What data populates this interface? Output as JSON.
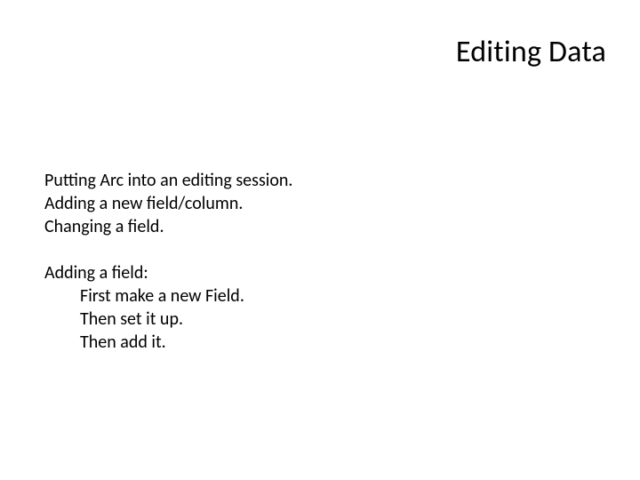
{
  "title": "Editing Data",
  "section1": {
    "line1": "Putting Arc into an editing session.",
    "line2": "Adding a new field/column.",
    "line3": "Changing a field."
  },
  "section2": {
    "header": "Adding a field:",
    "step1": "First make a new Field.",
    "step2": "Then set it up.",
    "step3": "Then add it."
  }
}
